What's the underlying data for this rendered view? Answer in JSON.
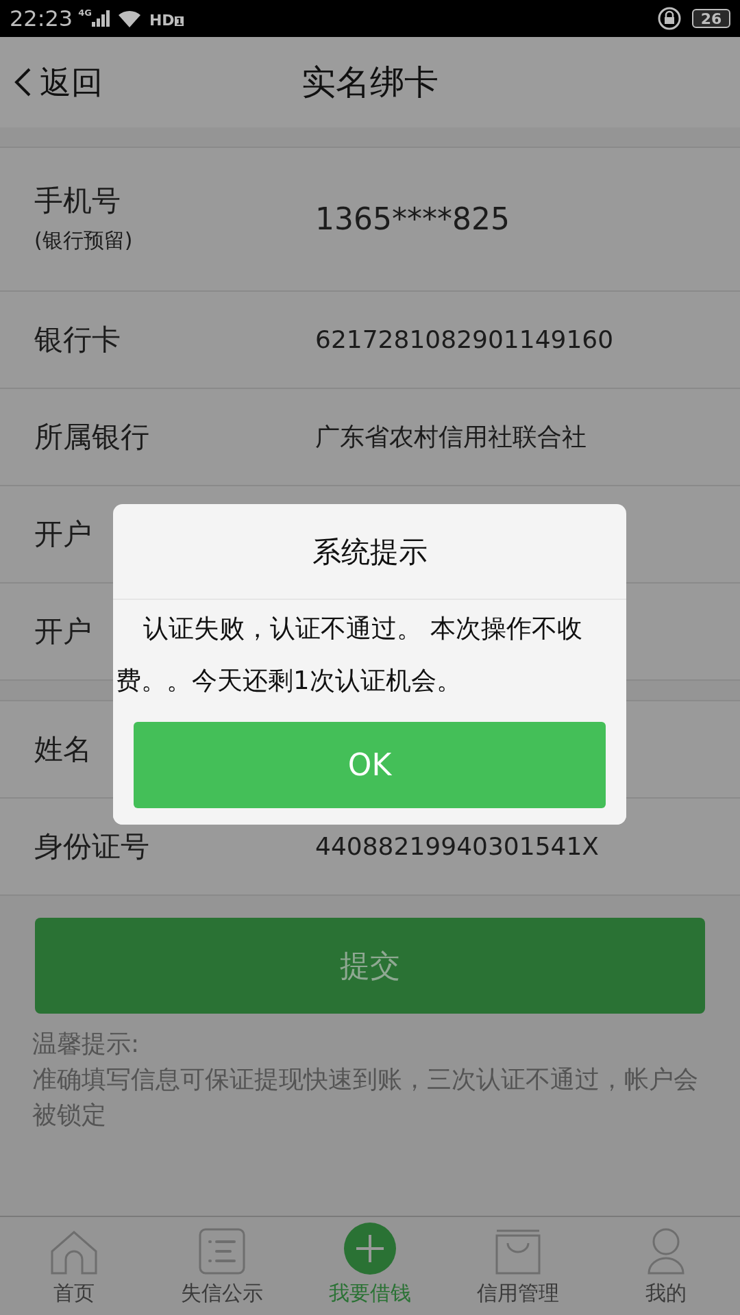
{
  "status_bar": {
    "time": "22:23",
    "network": "4G",
    "call": "HD",
    "sim": "1",
    "battery": "26"
  },
  "header": {
    "back": "返回",
    "title": "实名绑卡"
  },
  "form": {
    "sections": [
      {
        "rows": [
          {
            "label": "手机号",
            "sublabel": "(银行预留)",
            "value": "1365****825"
          },
          {
            "label": "银行卡",
            "value": "6217281082901149160"
          },
          {
            "label": "所属银行",
            "value": "广东省农村信用社联合社"
          },
          {
            "label": "开户"
          },
          {
            "label": "开户"
          }
        ]
      },
      {
        "rows": [
          {
            "label": "姓名"
          },
          {
            "label": "身份证号",
            "value": "44088219940301541X"
          }
        ]
      }
    ]
  },
  "submit": {
    "label": "提交",
    "disabled": true
  },
  "tips": {
    "title": "温馨提示:",
    "text": "准确填写信息可保证提现快速到账，三次认证不通过，帐户会被锁定"
  },
  "tab_bar": [
    {
      "label": "首页",
      "kind": "home",
      "selected": false
    },
    {
      "label": "失信公示",
      "kind": "list",
      "selected": false
    },
    {
      "label": "我要借钱",
      "kind": "plus",
      "selected": true
    },
    {
      "label": "信用管理",
      "kind": "bag",
      "selected": false
    },
    {
      "label": "我的",
      "kind": "person",
      "selected": false
    }
  ],
  "dialog": {
    "title": "系统提示",
    "message": "认证失败，认证不通过。 本次操作不收费。。今天还剩1次认证机会。",
    "button": "OK"
  }
}
